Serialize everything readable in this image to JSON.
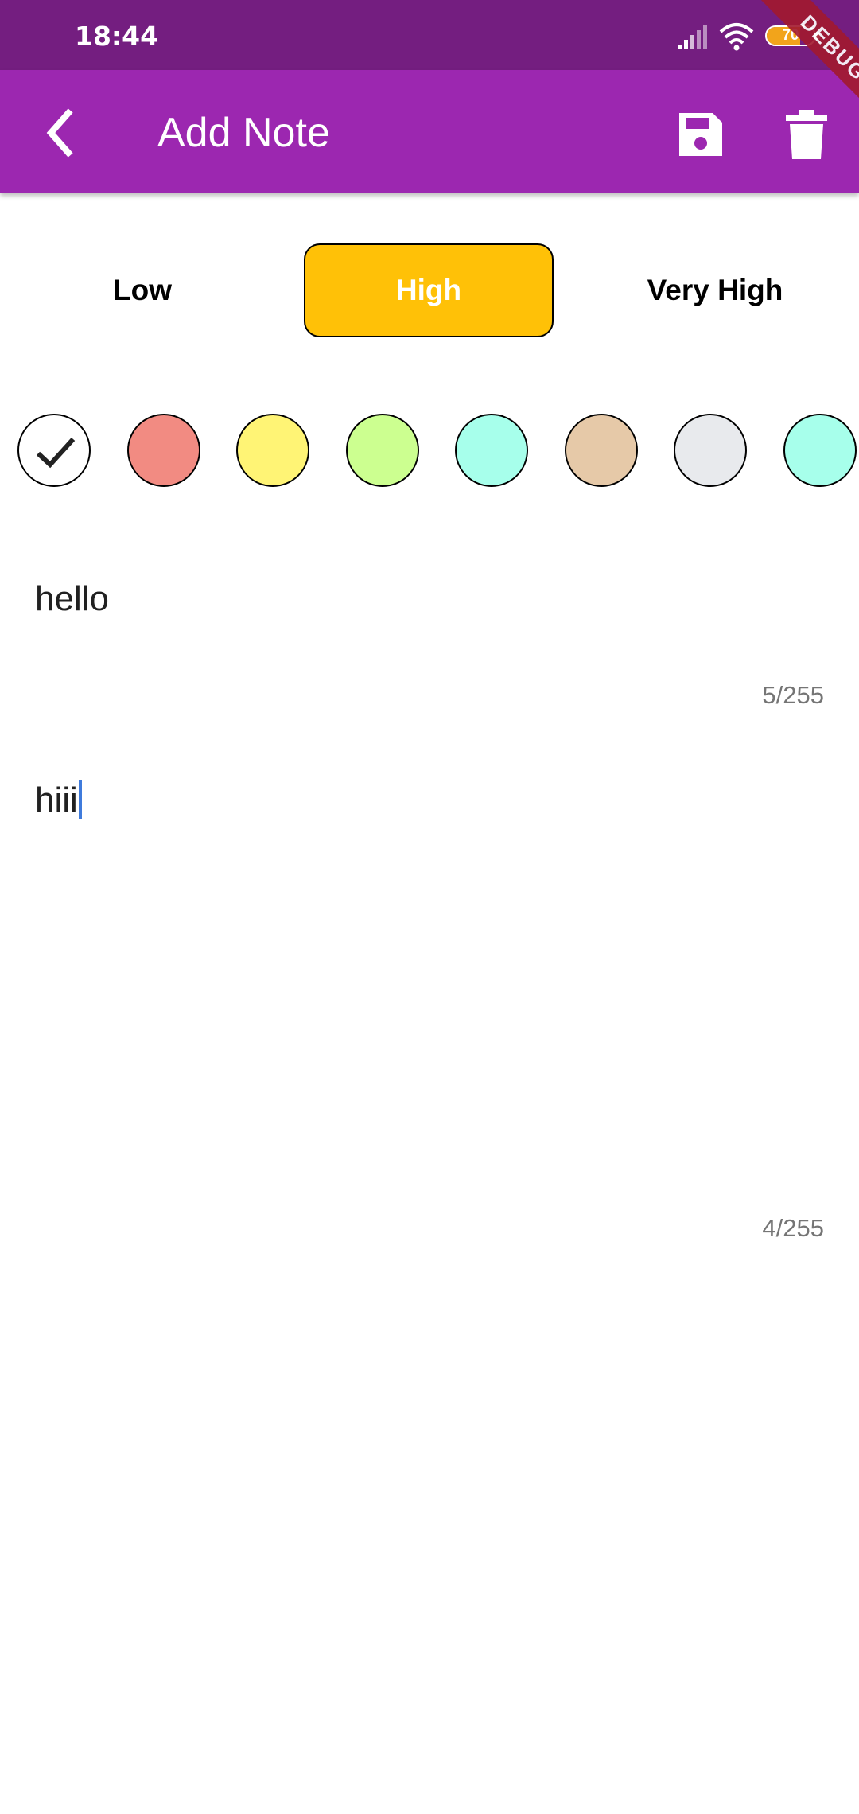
{
  "status_bar": {
    "time": "18:44",
    "battery_level": "70",
    "battery_fraction": 0.7
  },
  "app_bar": {
    "title": "Add Note",
    "background": "#9c27b0",
    "icons": [
      "back-arrow-icon",
      "save-icon",
      "trash-icon"
    ]
  },
  "debug_banner": "DEBUG",
  "priority": {
    "options": [
      "Low",
      "High",
      "Very High"
    ],
    "selected": "High",
    "selected_color": "#ffc107"
  },
  "colors": {
    "selected_index": 0,
    "swatches": [
      "#ffffff",
      "#f28b82",
      "#fff475",
      "#ccff90",
      "#a7ffeb",
      "#e6c9a8",
      "#e8eaed",
      "#a7ffeb"
    ]
  },
  "title_field": {
    "value": "hello",
    "counter": "5/255"
  },
  "description_field": {
    "value": "hiii",
    "counter": "4/255"
  }
}
